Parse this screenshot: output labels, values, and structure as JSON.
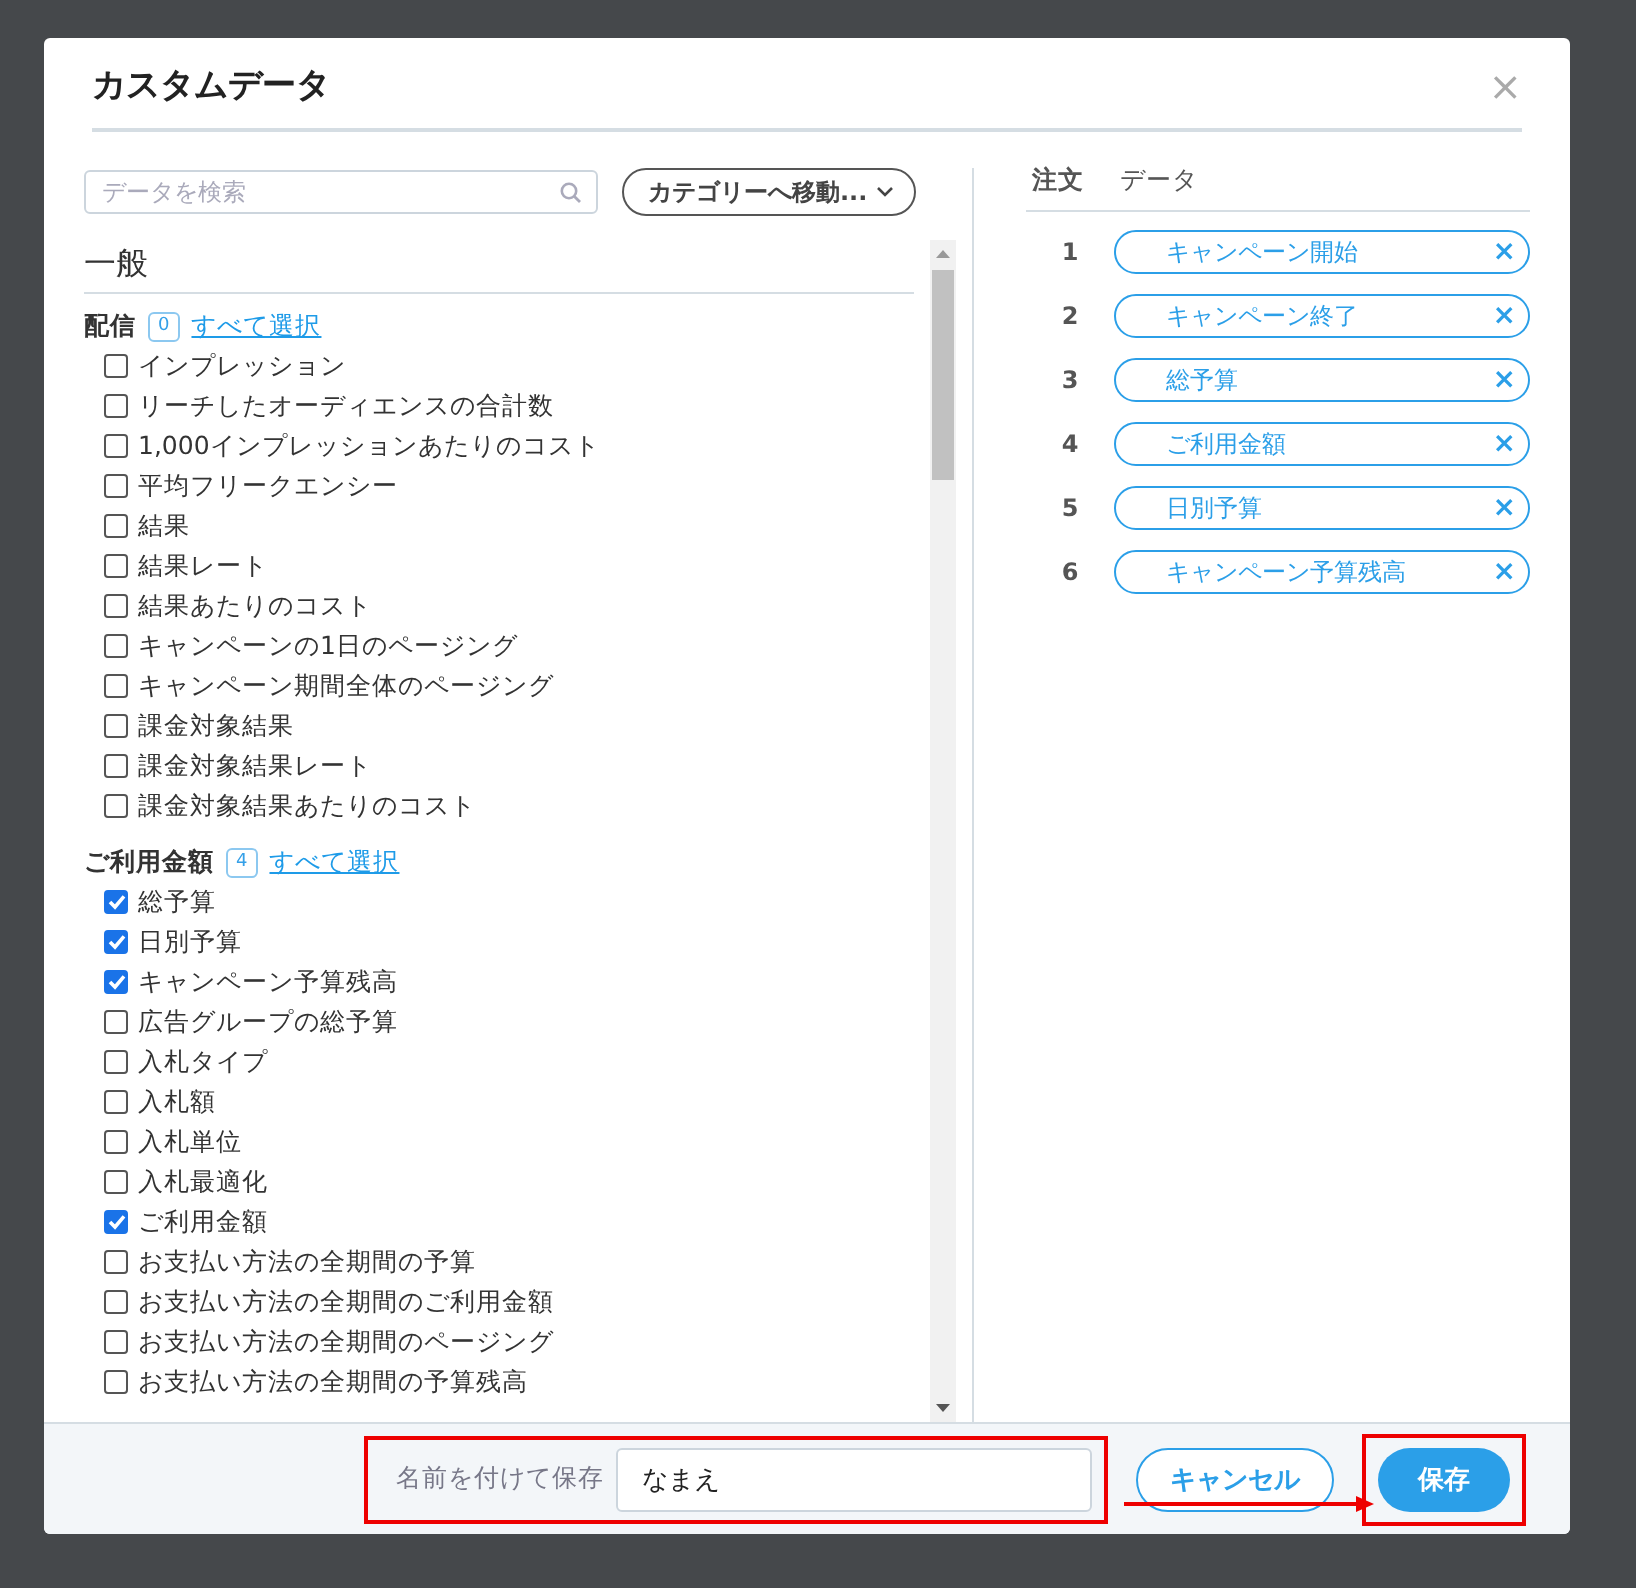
{
  "dialog": {
    "title": "カスタムデータ",
    "close": "×"
  },
  "search": {
    "placeholder": "データを検索"
  },
  "category_jump": {
    "label": "カテゴリーへ移動..."
  },
  "section": {
    "title": "一般"
  },
  "groups": [
    {
      "name": "配信",
      "count": "0",
      "select_all": "すべて選択",
      "items": [
        {
          "label": "インプレッション",
          "checked": false
        },
        {
          "label": "リーチしたオーディエンスの合計数",
          "checked": false
        },
        {
          "label": "1,000インプレッションあたりのコスト",
          "checked": false
        },
        {
          "label": "平均フリークエンシー",
          "checked": false
        },
        {
          "label": "結果",
          "checked": false
        },
        {
          "label": "結果レート",
          "checked": false
        },
        {
          "label": "結果あたりのコスト",
          "checked": false
        },
        {
          "label": "キャンペーンの1日のページング",
          "checked": false
        },
        {
          "label": "キャンペーン期間全体のページング",
          "checked": false
        },
        {
          "label": "課金対象結果",
          "checked": false
        },
        {
          "label": "課金対象結果レート",
          "checked": false
        },
        {
          "label": "課金対象結果あたりのコスト",
          "checked": false
        }
      ]
    },
    {
      "name": "ご利用金額",
      "count": "4",
      "select_all": "すべて選択",
      "items": [
        {
          "label": "総予算",
          "checked": true
        },
        {
          "label": "日別予算",
          "checked": true
        },
        {
          "label": "キャンペーン予算残高",
          "checked": true
        },
        {
          "label": "広告グループの総予算",
          "checked": false
        },
        {
          "label": "入札タイプ",
          "checked": false
        },
        {
          "label": "入札額",
          "checked": false
        },
        {
          "label": "入札単位",
          "checked": false
        },
        {
          "label": "入札最適化",
          "checked": false
        },
        {
          "label": "ご利用金額",
          "checked": true
        },
        {
          "label": "お支払い方法の全期間の予算",
          "checked": false
        },
        {
          "label": "お支払い方法の全期間のご利用金額",
          "checked": false
        },
        {
          "label": "お支払い方法の全期間のページング",
          "checked": false
        },
        {
          "label": "お支払い方法の全期間の予算残高",
          "checked": false
        }
      ]
    }
  ],
  "selected_table": {
    "columns": [
      "注文",
      "データ"
    ],
    "rows": [
      {
        "order": "1",
        "data": "キャンペーン開始",
        "remove": "×"
      },
      {
        "order": "2",
        "data": "キャンペーン終了",
        "remove": "×"
      },
      {
        "order": "3",
        "data": "総予算",
        "remove": "×"
      },
      {
        "order": "4",
        "data": "ご利用金額",
        "remove": "×"
      },
      {
        "order": "5",
        "data": "日別予算",
        "remove": "×"
      },
      {
        "order": "6",
        "data": "キャンペーン予算残高",
        "remove": "×"
      }
    ]
  },
  "footer": {
    "save_as": {
      "label": "名前を付けて保存",
      "value": "なまえ",
      "highlighted": true
    },
    "buttons": [
      {
        "label": "キャンセル",
        "kind": "secondary",
        "highlighted": false
      },
      {
        "label": "保存",
        "kind": "primary",
        "highlighted": true
      }
    ],
    "arrow_to_save": true
  }
}
